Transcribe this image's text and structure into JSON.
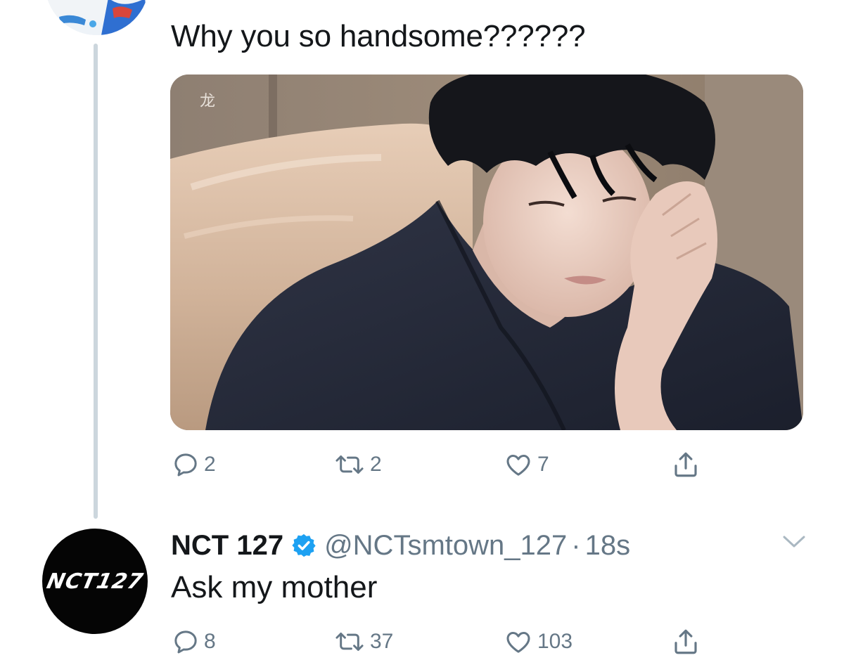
{
  "reply_tweet": {
    "text": "Why you so handsome??????",
    "media_watermark": "龙",
    "actions": {
      "reply_count": "2",
      "retweet_count": "2",
      "like_count": "7"
    }
  },
  "author_tweet": {
    "avatar_logo_text": "NCT127",
    "display_name": "NCT 127",
    "handle": "@NCTsmtown_127",
    "separator": "·",
    "timestamp": "18s",
    "text": "Ask my mother",
    "actions": {
      "reply_count": "8",
      "retweet_count": "37",
      "like_count": "103"
    }
  },
  "icons": {
    "reply": "reply-icon",
    "retweet": "retweet-icon",
    "like": "heart-icon",
    "share": "share-icon",
    "verified": "verified-badge-icon",
    "more": "chevron-down-icon"
  },
  "colors": {
    "text_primary": "#14171a",
    "text_secondary": "#657786",
    "verified_blue": "#1da1f2",
    "thread_line": "#ccd6dd"
  }
}
